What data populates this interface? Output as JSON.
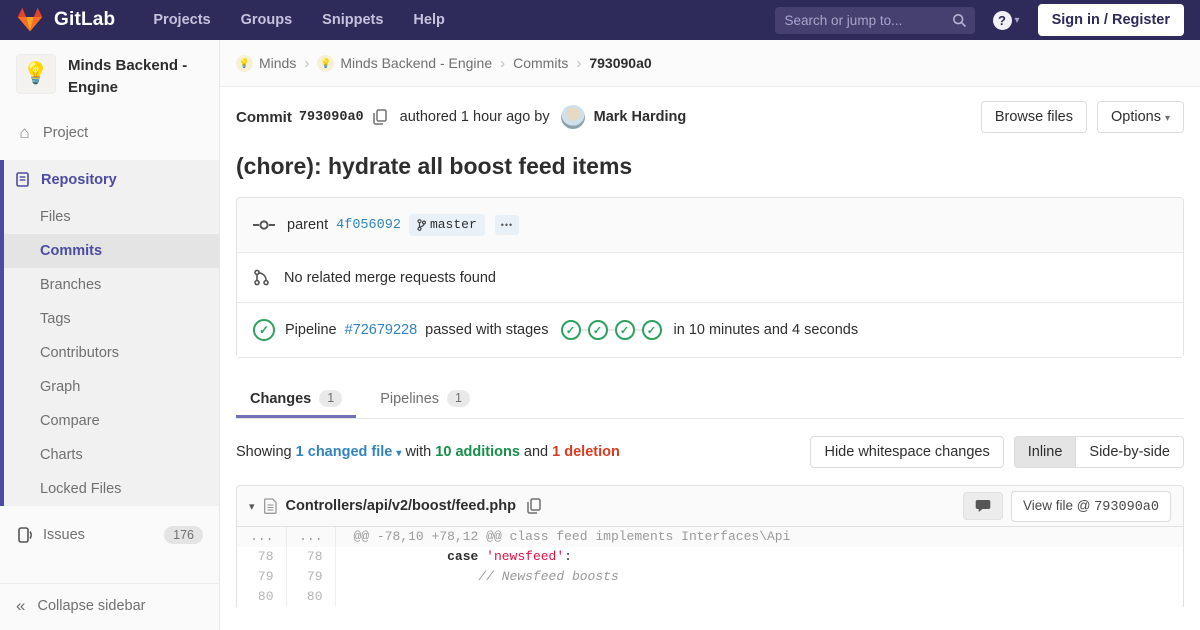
{
  "colors": {
    "navbar_bg": "#2e2a59",
    "accent_indigo": "#4b4ba3",
    "link_blue": "#3084bb",
    "success_green": "#2da160",
    "addition_green": "#168f48",
    "deletion_red": "#db3b21",
    "string_red": "#dd1144"
  },
  "icons": {
    "caret_down": "▾",
    "collapse": "«",
    "check": "✓",
    "question": "?",
    "home": "⌂",
    "crumb_separator": "›"
  },
  "navbar": {
    "brand": "GitLab",
    "links": {
      "projects": "Projects",
      "groups": "Groups",
      "snippets": "Snippets",
      "help": "Help"
    },
    "search_placeholder": "Search or jump to...",
    "signin": "Sign in / Register"
  },
  "sidebar": {
    "avatar": "💡",
    "project_title": "Minds Backend - Engine",
    "project_item": "Project",
    "repository": "Repository",
    "repo_subitems": [
      "Files",
      "Commits",
      "Branches",
      "Tags",
      "Contributors",
      "Graph",
      "Compare",
      "Charts",
      "Locked Files"
    ],
    "issues_label": "Issues",
    "issues_count": "176",
    "collapse_label": "Collapse sidebar"
  },
  "breadcrumb": {
    "avatar": "💡",
    "minds": "Minds",
    "project": "Minds Backend - Engine",
    "commits": "Commits",
    "sha": "793090a0"
  },
  "commit_header": {
    "commit_label": "Commit",
    "sha": "793090a0",
    "authored_text": "authored 1 hour ago by",
    "author_name": "Mark Harding",
    "browse_files": "Browse files",
    "options": "Options"
  },
  "commit": {
    "title": "(chore): hydrate all boost feed items",
    "parent_label": "parent",
    "parent_sha": "4f056092",
    "branch_name": "master",
    "ellipsis": "•••",
    "no_mr_text": "No related merge requests found",
    "pipeline_label": "Pipeline",
    "pipeline_id": "#72679228",
    "pipeline_status": "passed with stages",
    "pipeline_duration": "in 10 minutes and 4 seconds"
  },
  "tabs": {
    "changes_label": "Changes",
    "changes_count": "1",
    "pipelines_label": "Pipelines",
    "pipelines_count": "1"
  },
  "summary": {
    "showing": "Showing",
    "changed_file": "1 changed file",
    "with_text": "with",
    "additions": "10 additions",
    "and_text": "and",
    "deletion": "1 deletion"
  },
  "controls": {
    "hide_whitespace": "Hide whitespace changes",
    "inline": "Inline",
    "side_by_side": "Side-by-side"
  },
  "diff": {
    "file_path": "Controllers/api/v2/boost/feed.php",
    "view_file_prefix": "View file @ ",
    "view_file_sha": "793090a0",
    "hunk_old_marker": "...",
    "hunk_new_marker": "...",
    "hunk_header": "@@ -78,10 +78,12 @@ class feed implements Interfaces\\Api",
    "rows": [
      {
        "old": "78",
        "new": "78",
        "indent": "            ",
        "keyword": "case ",
        "string": "'newsfeed'",
        "suffix": ":"
      },
      {
        "old": "79",
        "new": "79",
        "indent": "                ",
        "comment": "// Newsfeed boosts"
      },
      {
        "old": "80",
        "new": "80"
      }
    ]
  }
}
